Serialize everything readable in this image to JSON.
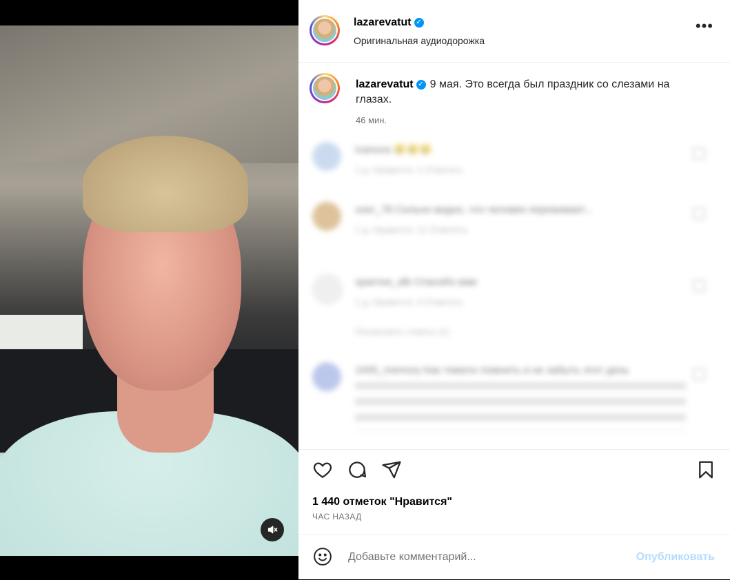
{
  "post": {
    "author": {
      "username": "lazarevatut",
      "verified": true
    },
    "audio": "Оригинальная аудиодорожка",
    "caption": {
      "username": "lazarevatut",
      "text": "9 мая. Это всегда был праздник со слезами на глазах.",
      "time": "46 мин."
    },
    "likes": "1 440 отметок \"Нравится\"",
    "posted": "ЧАС НАЗАД",
    "more_label": "•••"
  },
  "comments_blurred": [
    {
      "text": "ivanova 😢😢😢",
      "meta": "1 д.   Нравится: 1   Ответить"
    },
    {
      "text": "user_78 Сильно видно, что человек переживает...",
      "meta": "1 д.   Нравится: 12   Ответить"
    },
    {
      "text": "sparrow_alb Спасибо вам",
      "meta": "1 д.   Нравится: 4   Ответить",
      "replies": "Посмотреть ответы (1)"
    },
    {
      "text": "1945_memory Как тяжело помнить и не забыть этот день",
      "meta": ""
    }
  ],
  "composer": {
    "placeholder": "Добавьте комментарий...",
    "publish_label": "Опубликовать"
  },
  "icons": {
    "mute": "speaker-muted-icon",
    "more": "more-horizontal-icon",
    "like": "heart-icon",
    "comment": "comment-bubble-icon",
    "share": "paper-plane-icon",
    "save": "bookmark-icon",
    "emoji": "emoji-smile-icon",
    "verified": "verified-badge-icon"
  },
  "colors": {
    "verified": "#0095f6",
    "publish_disabled": "#b3dbff",
    "story_ring": [
      "#feda75",
      "#fa7e1e",
      "#d62976",
      "#962fbf",
      "#4f5bd5"
    ]
  }
}
